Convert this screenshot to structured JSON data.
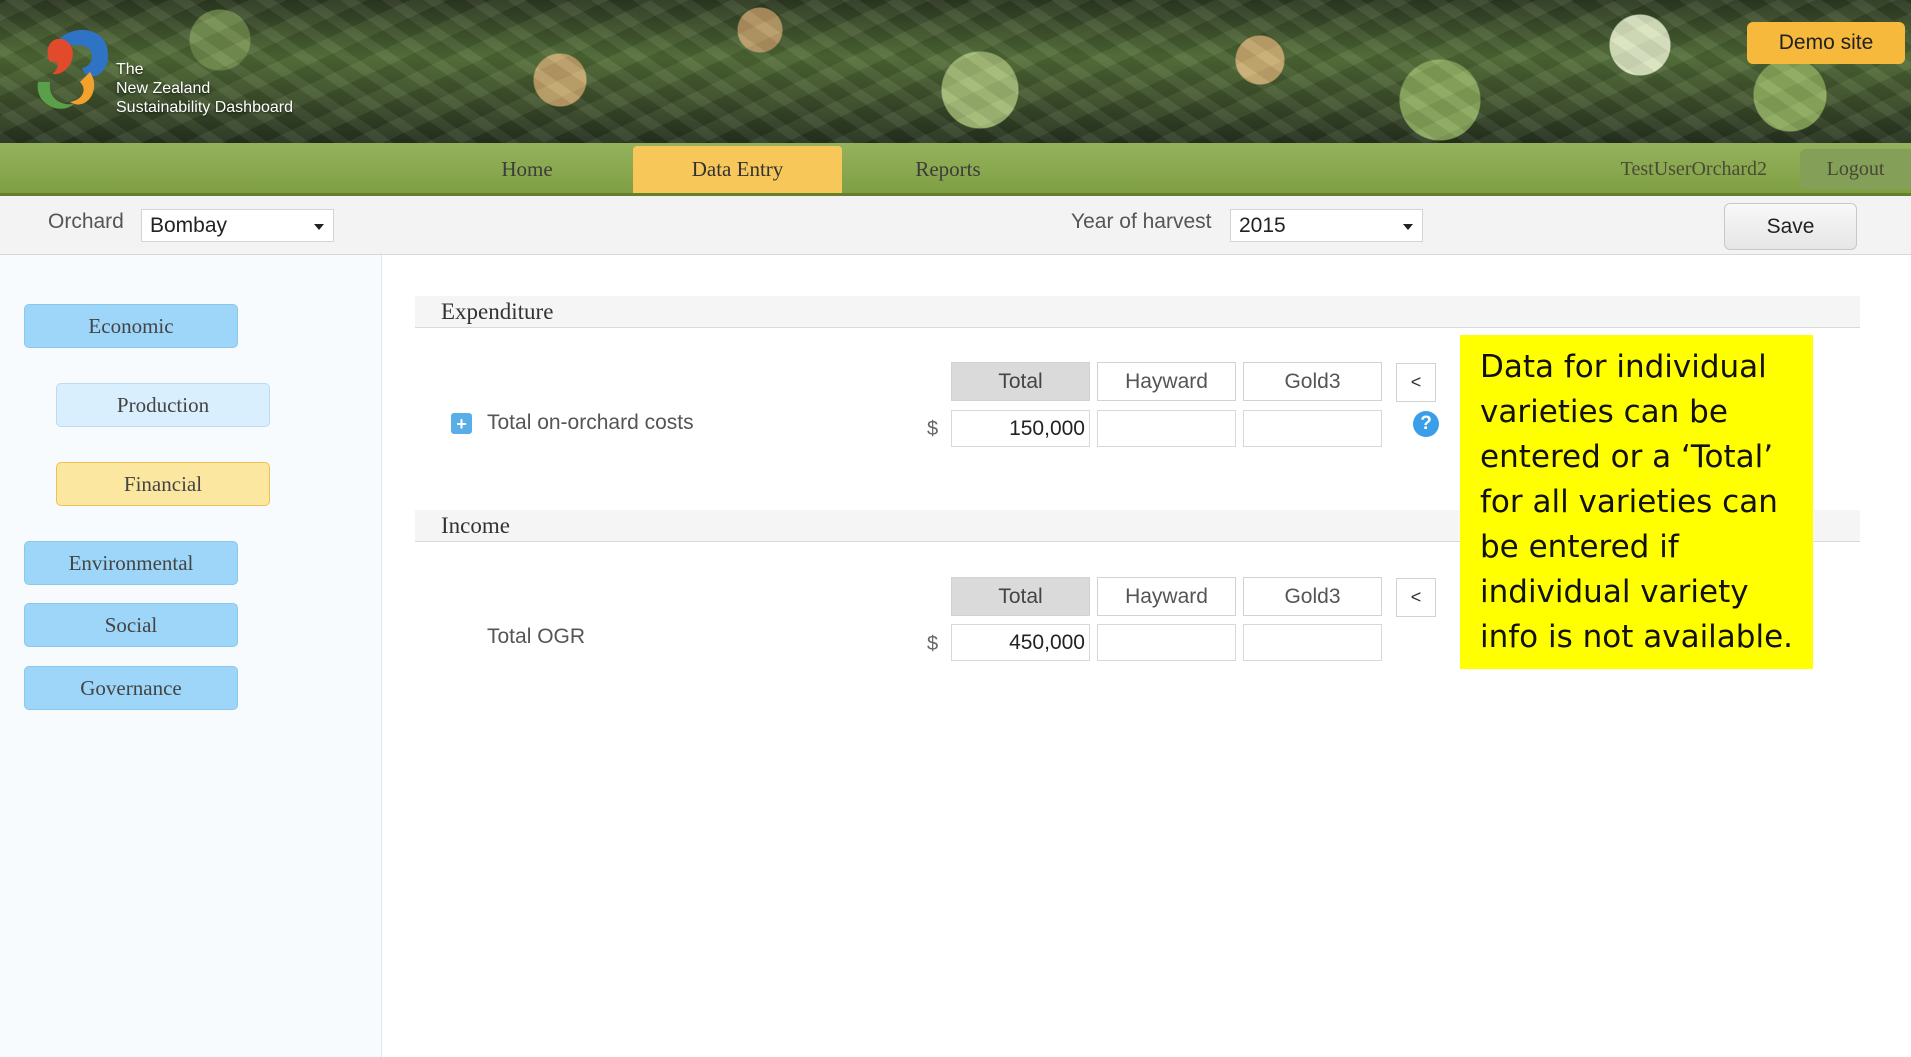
{
  "header": {
    "brand_line1": "The",
    "brand_line2": "New Zealand",
    "brand_line3": "Sustainability Dashboard",
    "demo_label": "Demo site"
  },
  "nav": {
    "tabs": [
      {
        "label": "Home"
      },
      {
        "label": "Data Entry",
        "active": true
      },
      {
        "label": "Reports"
      }
    ],
    "user": "TestUserOrchard2",
    "logout": "Logout"
  },
  "filters": {
    "orchard_label": "Orchard",
    "orchard_value": "Bombay",
    "year_label": "Year of harvest",
    "year_value": "2015",
    "save": "Save"
  },
  "sidebar": {
    "items": [
      {
        "label": "Economic",
        "level": "main"
      },
      {
        "label": "Production",
        "level": "sub"
      },
      {
        "label": "Financial",
        "level": "sub",
        "active": true
      },
      {
        "label": "Environmental",
        "level": "main"
      },
      {
        "label": "Social",
        "level": "main"
      },
      {
        "label": "Governance",
        "level": "main"
      }
    ]
  },
  "sections": {
    "expenditure": {
      "title": "Expenditure",
      "columns": [
        "Total",
        "Hayward",
        "Gold3"
      ],
      "collapse": "<",
      "row_label": "Total on-orchard costs",
      "currency": "$",
      "values": [
        "150,000",
        "",
        ""
      ]
    },
    "income": {
      "title": "Income",
      "columns": [
        "Total",
        "Hayward",
        "Gold3"
      ],
      "collapse": "<",
      "row_label": "Total OGR",
      "currency": "$",
      "values": [
        "450,000",
        "",
        ""
      ]
    }
  },
  "icons": {
    "expand": "+",
    "help": "?"
  },
  "callout": "Data for individual varieties can be entered or a ‘Total’ for all varieties can be entered if individual variety info is not available.",
  "colors": {
    "nav_green": "#7f9f44",
    "active_tab": "#f8c75a",
    "sidebar_main": "#9dd6f8",
    "callout_yellow": "#ffff00"
  }
}
